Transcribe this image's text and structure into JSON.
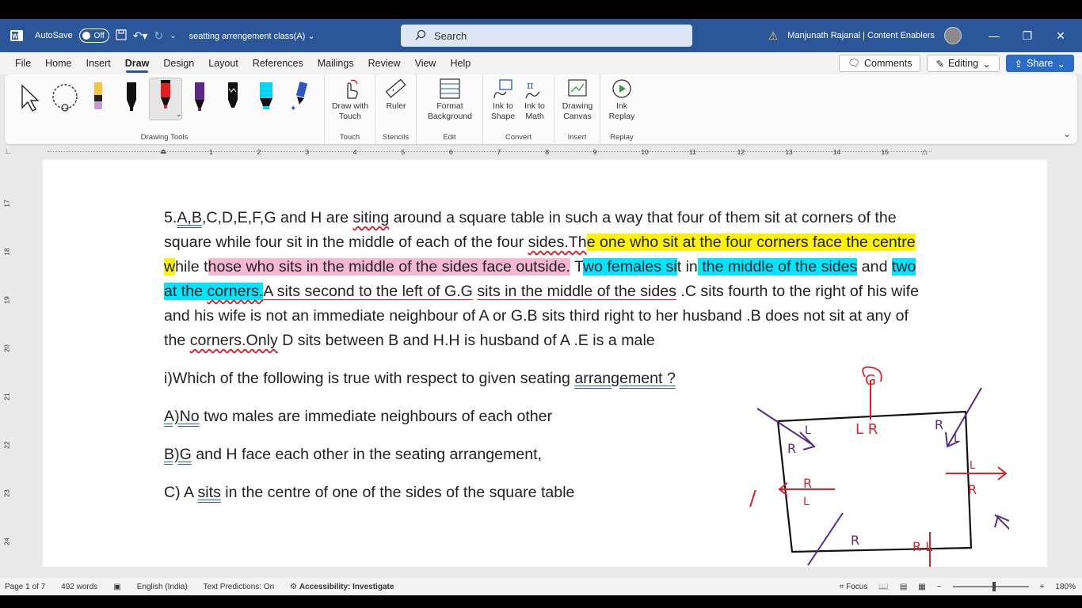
{
  "titlebar": {
    "autosave_label": "AutoSave",
    "autosave_state": "Off",
    "doc_title": "seatting arrengement class(A)",
    "search_placeholder": "Search",
    "user_name": "Manjunath Rajanal | Content Enablers"
  },
  "menu": {
    "tabs": [
      "File",
      "Home",
      "Insert",
      "Draw",
      "Design",
      "Layout",
      "References",
      "Mailings",
      "Review",
      "View",
      "Help"
    ],
    "active_tab": "Draw",
    "comments_label": "Comments",
    "editing_label": "Editing",
    "share_label": "Share"
  },
  "ribbon": {
    "drawing_tools_label": "Drawing Tools",
    "draw_with_touch": "Draw with Touch",
    "touch_label": "Touch",
    "ruler": "Ruler",
    "stencils_label": "Stencils",
    "format_background": "Format Background",
    "edit_label": "Edit",
    "ink_to_shape": "Ink to Shape",
    "ink_to_math": "Ink to Math",
    "convert_label": "Convert",
    "drawing_canvas": "Drawing Canvas",
    "insert_label": "Insert",
    "ink_replay": "Ink Replay",
    "replay_label": "Replay"
  },
  "ruler": {
    "h_numbers": [
      "1",
      "2",
      "3",
      "4",
      "5",
      "6",
      "7",
      "8",
      "9",
      "10",
      "11",
      "12",
      "13",
      "14",
      "15"
    ],
    "v_numbers": [
      "17",
      "18",
      "19",
      "20",
      "21",
      "22",
      "23",
      "24"
    ]
  },
  "document": {
    "q_parts": [
      "5.",
      "A,B",
      ",C,D,E,F,G and H are ",
      "siting",
      " around a square table in such a way that four of them sit at corners of the square while four sit in the middle of each of the four ",
      "sides.Th",
      "e one who sit at the four corners face the centre w",
      "hile t",
      "hose who sits in the middle of the sides face outside.",
      " T",
      "wo females si",
      "t in",
      " the middle of the sides",
      " and ",
      "two at the ",
      "corners.",
      "A sits second to the left of G.G",
      " ",
      "sits in the middle of the sides",
      " .C sits fourth to the right of his wife and his wife is not an immediate neighbour of A or G.B sits third right to her husband .B does not sit at any of the ",
      "corners.Only",
      " D sits between B and H.H is husband of A .E is a male"
    ],
    "question_prefix": "i)Which of the following is true with respect to given seating ",
    "question_underlined": "arrangement ?",
    "option_a_prefix": "A)No",
    "option_a_rest": " two males are immediate neighbours of each other",
    "option_b_prefix": "B)G",
    "option_b_rest": " and H face each other in the seating arrangement,",
    "option_c_prefix": "C) A ",
    "option_c_sits": "sits",
    "option_c_rest": " in the centre of one of the sides of the square table"
  },
  "ink": {
    "top_letter": "G",
    "top_lr": "L R",
    "corner_tl": "R",
    "corner_tl2": "L",
    "corner_tr": "R",
    "corner_tr2": "L",
    "right_mid_l": "L",
    "right_mid_r": "R",
    "left_mid_r": "R",
    "left_mid_l": "L",
    "left_mark": "/",
    "bottom_rl": "R L",
    "corner_bl": "R",
    "corner_br": "R",
    "colors": {
      "red": "#d9222a",
      "purple": "#5b2a86",
      "black": "#111111"
    }
  },
  "status": {
    "page": "Page 1 of 7",
    "words": "492 words",
    "language": "English (India)",
    "predictions": "Text Predictions: On",
    "accessibility": "Accessibility: Investigate",
    "focus": "Focus",
    "zoom": "180%"
  }
}
